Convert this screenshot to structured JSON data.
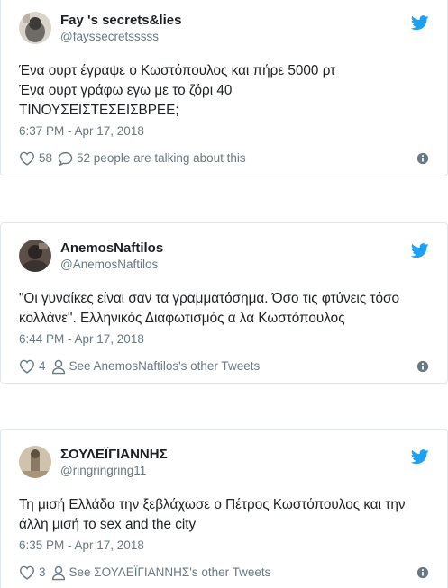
{
  "colors": {
    "accent": "#1da1f2",
    "secondary_text": "#697882",
    "primary_text": "#1c2022",
    "border": "#e1e8ed"
  },
  "tweets": [
    {
      "display_name": "Fay 's secrets&lies",
      "handle": "@fayssecretsssss",
      "text": "Ένα ουρτ έγραψε ο Κωστόπουλος και πήρε 5000 ρτ\nΈνα ουρτ γράφω εγω με το ζόρι 40\nΤΙΝΟΥΣΕΙΣΤΕΣΕΙΣΒΡΕΕ;",
      "timestamp": "6:37 PM - Apr 17, 2018",
      "like_count": "58",
      "secondary_action": "52 people are talking about this",
      "secondary_icon": "reply-bubble-icon",
      "avatar_color": "#6e6a66"
    },
    {
      "display_name": "AnemosNaftilos",
      "handle": "@AnemosNaftilos",
      "text": "\"Οι γυναίκες είναι σαν τα γραμματόσημα. Όσο τις φτύνεις τόσο κολλάνε\". Ελληνικός Διαφωτισμός α λα Κωστόπουλος",
      "timestamp": "6:44 PM - Apr 17, 2018",
      "like_count": "4",
      "secondary_action": "See AnemosNaftilos's other Tweets",
      "secondary_icon": "person-icon",
      "avatar_color": "#3a3330"
    },
    {
      "display_name": "ΣΟΥΛΕΪΓΙΑΝΝΗΣ",
      "handle": "@ringringring11",
      "text": "Τη μισή Ελλάδα την ξεβλάχωσε ο Πέτρος Κωστόπουλος και την άλλη μισή το sex and the city",
      "timestamp": "6:35 PM - Apr 17, 2018",
      "like_count": "3",
      "secondary_action": "See ΣΟΥΛΕΪΓΙΑΝΝΗΣ's other Tweets",
      "secondary_icon": "person-icon",
      "avatar_color": "#8a7a63"
    }
  ]
}
